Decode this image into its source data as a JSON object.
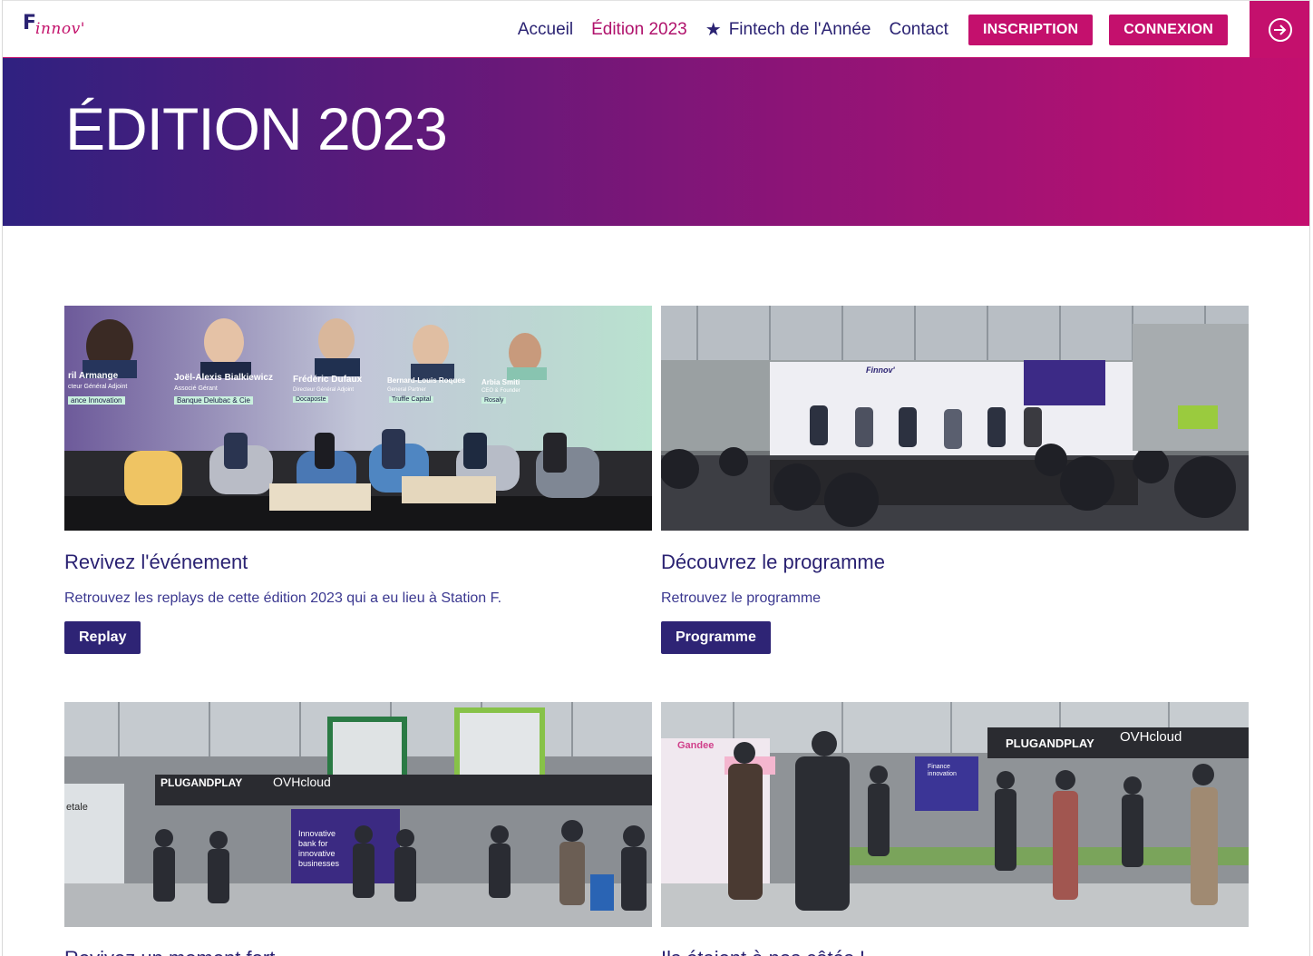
{
  "brand": {
    "logo_initial": "F",
    "logo_rest": "innov'",
    "primary": "#2a2272",
    "accent": "#c4106d"
  },
  "nav": {
    "items": [
      "Accueil",
      "Édition 2023",
      "Fintech de l'Année",
      "Contact"
    ],
    "star_icon": "★",
    "inscription": "INSCRIPTION",
    "connexion": "CONNEXION",
    "login_icon": "sign-in-icon"
  },
  "hero": {
    "title": "ÉDITION 2023"
  },
  "cards": [
    {
      "title": "Revivez l'événement",
      "text": "Retrouvez les replays de cette édition 2023 qui a eu lieu à Station F.",
      "button": "Replay",
      "speakers": [
        {
          "name": "ril Armange",
          "role": "cteur Général Adjoint",
          "org": "ance Innovation"
        },
        {
          "name": "Joël-Alexis Bialkiewicz",
          "role": "Associé Gérant",
          "org": "Banque Delubac & Cie"
        },
        {
          "name": "Frédéric Dufaux",
          "role": "Directeur Général Adjoint",
          "org": "Docaposte"
        },
        {
          "name": "Bernard-Louis Roques",
          "role": "General Partner",
          "org": "Truffle Capital"
        },
        {
          "name": "Arbia Smiti",
          "role": "CEO & Founder",
          "org": "Rosaly"
        }
      ]
    },
    {
      "title": "Découvrez le programme",
      "text": "Retrouvez le programme",
      "button": "Programme",
      "backdrop_text": "Finnov'"
    },
    {
      "title": "Revivez un moment fort",
      "signs": [
        "PLUGANDPLAY",
        "OVHcloud",
        "Innovative bank for innovative businesses",
        "etale"
      ]
    },
    {
      "title": "Ils étaient à nos côtés !",
      "signs": [
        "PLUGANDPLAY",
        "OVHcloud",
        "Gandee",
        "Finance innovation"
      ]
    }
  ]
}
